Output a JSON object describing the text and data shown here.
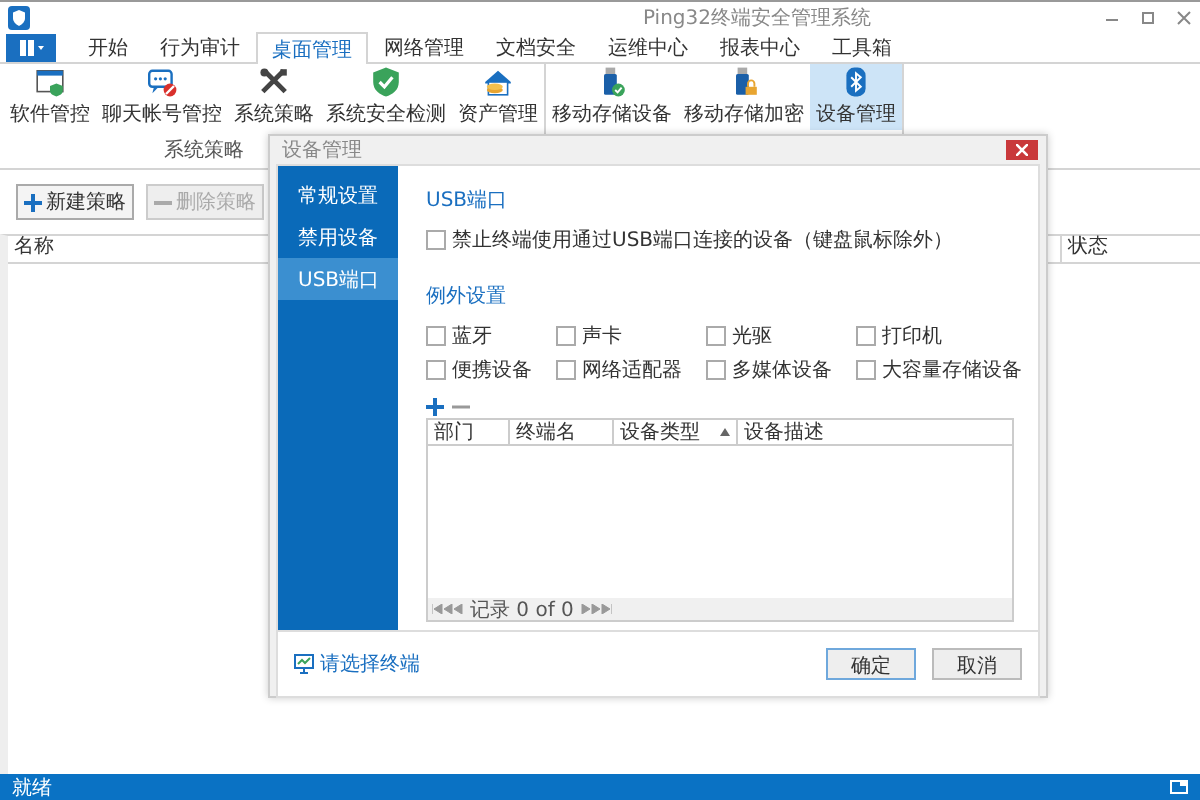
{
  "window": {
    "title": "Ping32终端安全管理系统"
  },
  "menu_tabs": [
    {
      "label": "开始",
      "selected": false
    },
    {
      "label": "行为审计",
      "selected": false
    },
    {
      "label": "桌面管理",
      "selected": true
    },
    {
      "label": "网络管理",
      "selected": false
    },
    {
      "label": "文档安全",
      "selected": false
    },
    {
      "label": "运维中心",
      "selected": false
    },
    {
      "label": "报表中心",
      "selected": false
    },
    {
      "label": "工具箱",
      "selected": false
    }
  ],
  "ribbon": {
    "groups": [
      {
        "label": "系统策略",
        "items": [
          {
            "label": "软件管控",
            "selected": false
          },
          {
            "label": "聊天帐号管控",
            "selected": false
          },
          {
            "label": "系统策略",
            "selected": false
          },
          {
            "label": "系统安全检测",
            "selected": false
          },
          {
            "label": "资产管理",
            "selected": false
          }
        ]
      },
      {
        "items": [
          {
            "label": "移动存储设备",
            "selected": false
          },
          {
            "label": "移动存储加密",
            "selected": false
          },
          {
            "label": "设备管理",
            "selected": true
          }
        ]
      }
    ]
  },
  "toolbar": [
    {
      "label": "新建策略",
      "disabled": false
    },
    {
      "label": "删除策略",
      "disabled": true
    }
  ],
  "policy_table": {
    "columns": [
      "名称",
      "状态"
    ]
  },
  "dialog": {
    "title": "设备管理",
    "nav": [
      {
        "label": "常规设置",
        "selected": false
      },
      {
        "label": "禁用设备",
        "selected": false
      },
      {
        "label": "USB端口",
        "selected": true
      }
    ],
    "section_title": "USB端口",
    "block_option": {
      "label": "禁止终端使用通过USB端口连接的设备（键盘鼠标除外）",
      "checked": false
    },
    "exceptions_title": "例外设置",
    "exceptions": [
      {
        "label": "蓝牙",
        "checked": false
      },
      {
        "label": "声卡",
        "checked": false
      },
      {
        "label": "光驱",
        "checked": false
      },
      {
        "label": "打印机",
        "checked": false
      },
      {
        "label": "便携设备",
        "checked": false
      },
      {
        "label": "网络适配器",
        "checked": false
      },
      {
        "label": "多媒体设备",
        "checked": false
      },
      {
        "label": "大容量存储设备",
        "checked": false
      }
    ],
    "table": {
      "columns": [
        {
          "label": "部门",
          "sorted": false
        },
        {
          "label": "终端名",
          "sorted": false
        },
        {
          "label": "设备类型",
          "sorted": true
        },
        {
          "label": "设备描述",
          "sorted": false
        }
      ],
      "pager": "记录 0 of 0"
    },
    "select_terminal": "请选择终端",
    "buttons": [
      {
        "label": "确定",
        "default": true
      },
      {
        "label": "取消",
        "default": false
      }
    ]
  },
  "status_bar": {
    "text": "就绪"
  }
}
